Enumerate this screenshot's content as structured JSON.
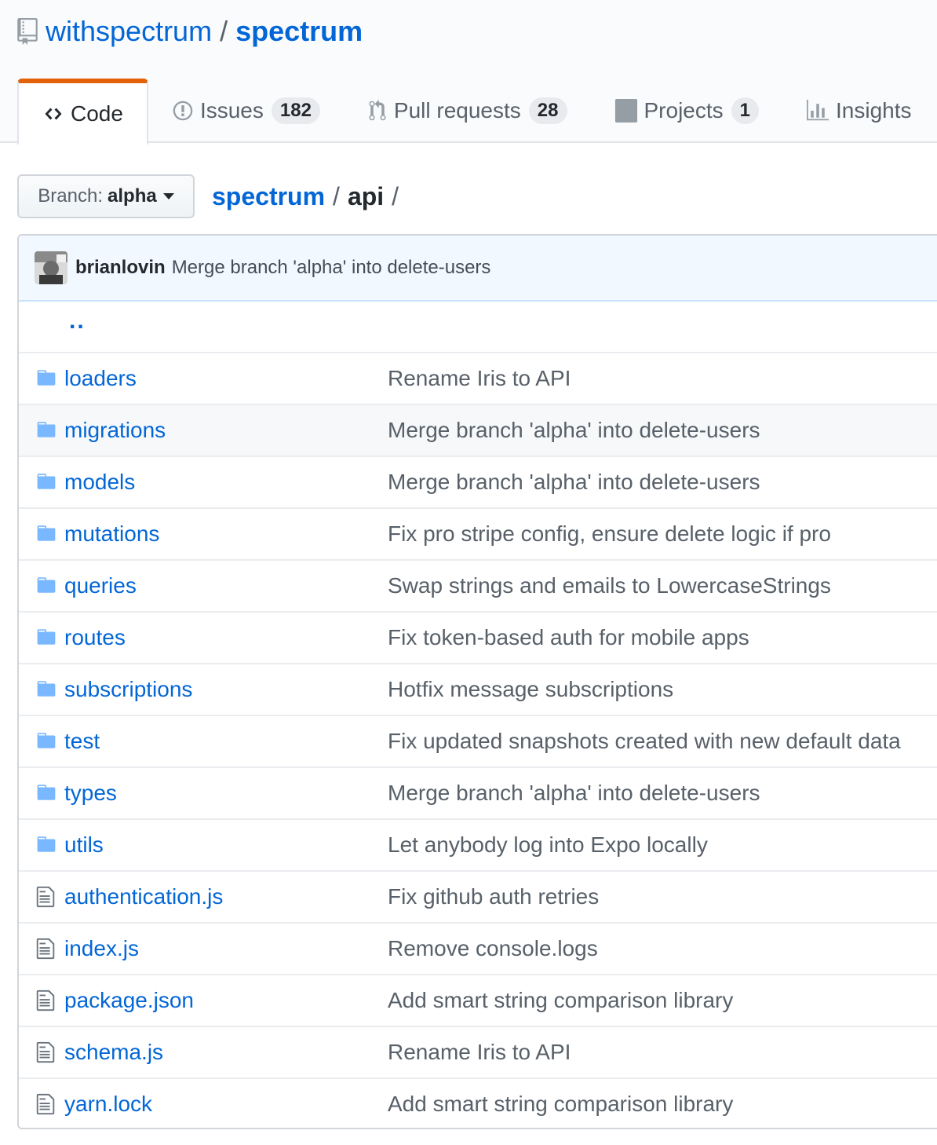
{
  "repo": {
    "owner": "withspectrum",
    "separator": "/",
    "name": "spectrum"
  },
  "tabs": [
    {
      "label": "Code",
      "icon": "code-icon",
      "selected": true
    },
    {
      "label": "Issues",
      "icon": "issue-opened-icon",
      "count": "182"
    },
    {
      "label": "Pull requests",
      "icon": "git-pull-request-icon",
      "count": "28"
    },
    {
      "label": "Projects",
      "icon": "project-icon",
      "count": "1"
    },
    {
      "label": "Insights",
      "icon": "graph-icon"
    }
  ],
  "branch": {
    "label": "Branch:",
    "value": "alpha"
  },
  "breadcrumb": {
    "root": "spectrum",
    "sep1": "/",
    "current": "api",
    "sep2": "/"
  },
  "latest_commit": {
    "author": "brianlovin",
    "message": "Merge branch 'alpha' into delete-users"
  },
  "up_dir": "..",
  "files": [
    {
      "type": "dir",
      "icon": "folder-icon",
      "name": "loaders",
      "message": "Rename Iris to API"
    },
    {
      "type": "dir",
      "icon": "folder-icon",
      "name": "migrations",
      "message": "Merge branch 'alpha' into delete-users"
    },
    {
      "type": "dir",
      "icon": "folder-icon",
      "name": "models",
      "message": "Merge branch 'alpha' into delete-users"
    },
    {
      "type": "dir",
      "icon": "folder-icon",
      "name": "mutations",
      "message": "Fix pro stripe config, ensure delete logic if pro"
    },
    {
      "type": "dir",
      "icon": "folder-icon",
      "name": "queries",
      "message": "Swap strings and emails to LowercaseStrings"
    },
    {
      "type": "dir",
      "icon": "folder-icon",
      "name": "routes",
      "message": "Fix token-based auth for mobile apps"
    },
    {
      "type": "dir",
      "icon": "folder-icon",
      "name": "subscriptions",
      "message": "Hotfix message subscriptions"
    },
    {
      "type": "dir",
      "icon": "folder-icon",
      "name": "test",
      "message": "Fix updated snapshots created with new default data"
    },
    {
      "type": "dir",
      "icon": "folder-icon",
      "name": "types",
      "message": "Merge branch 'alpha' into delete-users"
    },
    {
      "type": "dir",
      "icon": "folder-icon",
      "name": "utils",
      "message": "Let anybody log into Expo locally"
    },
    {
      "type": "file",
      "icon": "file-icon",
      "name": "authentication.js",
      "message": "Fix github auth retries"
    },
    {
      "type": "file",
      "icon": "file-icon",
      "name": "index.js",
      "message": "Remove console.logs"
    },
    {
      "type": "file",
      "icon": "file-icon",
      "name": "package.json",
      "message": "Add smart string comparison library"
    },
    {
      "type": "file",
      "icon": "file-icon",
      "name": "schema.js",
      "message": "Rename Iris to API"
    },
    {
      "type": "file",
      "icon": "file-icon",
      "name": "yarn.lock",
      "message": "Add smart string comparison library"
    }
  ],
  "colors": {
    "link": "#0366d6",
    "accent_tab": "#e36209",
    "folder": "#79b8ff",
    "commit_bg": "#f1f8ff"
  }
}
